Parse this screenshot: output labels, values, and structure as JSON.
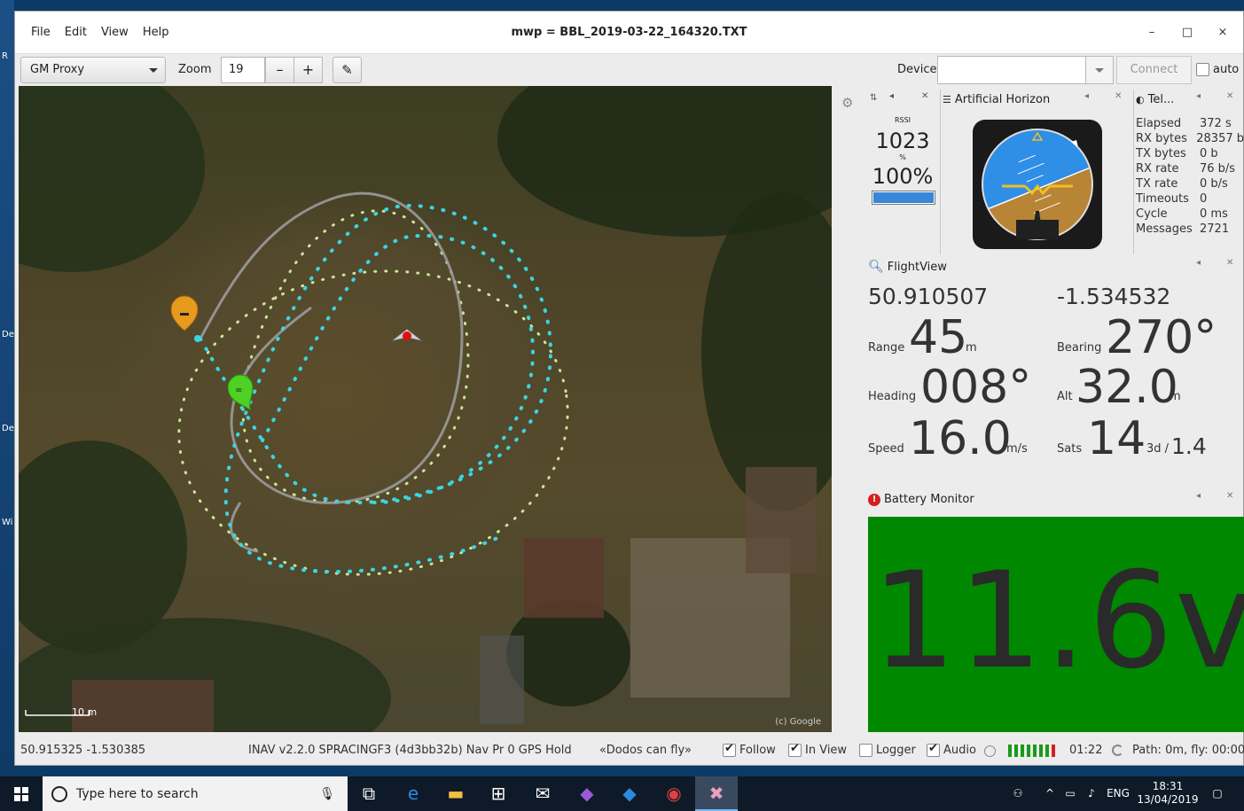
{
  "window": {
    "title": "mwp = BBL_2019-03-22_164320.TXT",
    "menu": [
      "File",
      "Edit",
      "View",
      "Help"
    ],
    "controls": {
      "minimize": "–",
      "maximize": "□",
      "close": "×"
    }
  },
  "toolbar": {
    "map_source": "GM Proxy",
    "zoom_label": "Zoom",
    "zoom_value": "19",
    "zoom_out": "–",
    "zoom_in": "+",
    "device_label": "Device",
    "device_value": "",
    "connect_label": "Connect",
    "auto_label": "auto",
    "auto_checked": false
  },
  "map": {
    "scale_label": "10 m",
    "copyright": "(c) Google"
  },
  "rssi": {
    "label": "RSSI",
    "value": "1023",
    "pct_label": "%",
    "pct_value": "100%",
    "level": 1.0
  },
  "horizon": {
    "title": "Artificial Horizon",
    "roll_deg": -22,
    "pitch_deg": -4
  },
  "telemetry": {
    "title": "Tel...",
    "rows": [
      {
        "k": "Elapsed",
        "v": "372 s"
      },
      {
        "k": "RX bytes",
        "v": "28357 b"
      },
      {
        "k": "TX bytes",
        "v": "0 b"
      },
      {
        "k": "RX rate",
        "v": "76 b/s"
      },
      {
        "k": "TX rate",
        "v": "0 b/s"
      },
      {
        "k": "Timeouts",
        "v": "0"
      },
      {
        "k": "Cycle",
        "v": "0 ms"
      },
      {
        "k": "Messages",
        "v": "2721"
      }
    ]
  },
  "flightview": {
    "title": "FlightView",
    "lat": "50.910507",
    "lon": "-1.534532",
    "range_label": "Range",
    "range": "45",
    "range_unit": "m",
    "bearing_label": "Bearing",
    "bearing": "270°",
    "heading_label": "Heading",
    "heading": "008°",
    "alt_label": "Alt",
    "alt": "32.0",
    "alt_unit": "m",
    "speed_label": "Speed",
    "speed": "16.0",
    "speed_unit": "m/s",
    "sats_label": "Sats",
    "sats": "14",
    "sats_fix": "3d /",
    "hdop": "1.4"
  },
  "battery": {
    "title": "Battery Monitor",
    "value": "11.6v",
    "color": "#008800"
  },
  "status": {
    "coords": "50.915325 -1.530385",
    "fc_info": "INAV v2.2.0  SPRACINGF3 (4d3bb32b) Nav Pr 0 GPS Hold",
    "craft_name": "«Dodos can fly»",
    "follow_label": "Follow",
    "follow": true,
    "inview_label": "In View",
    "inview": true,
    "logger_label": "Logger",
    "logger": false,
    "audio_label": "Audio",
    "audio": true,
    "flight_time": "01:22",
    "path": "Path: 0m, fly: 00:00"
  },
  "taskbar": {
    "search_placeholder": "Type here to search",
    "language": "ENG",
    "time": "18:31",
    "date": "13/04/2019"
  }
}
